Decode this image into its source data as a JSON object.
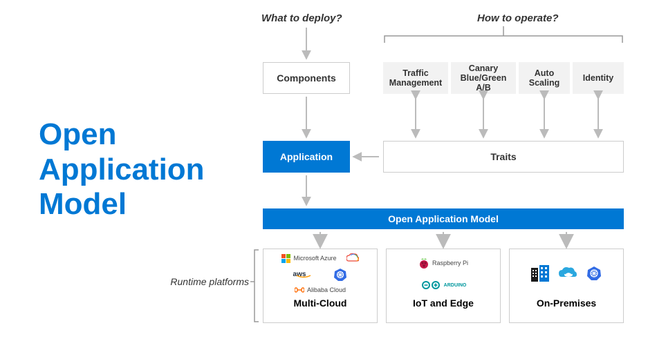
{
  "title": "Open Application Model",
  "questions": {
    "deploy": "What to deploy?",
    "operate": "How to operate?"
  },
  "components_label": "Components",
  "application_label": "Application",
  "traits_label": "Traits",
  "trait_items": {
    "traffic": "Traffic Management",
    "canary": "Canary Blue/Green A/B",
    "auto": "Auto Scaling",
    "identity": "Identity"
  },
  "oam_bar_label": "Open Application Model",
  "runtime_label": "Runtime platforms",
  "platforms": {
    "multicloud": {
      "label": "Multi-Cloud",
      "providers": {
        "azure": "Microsoft Azure",
        "gcp": "",
        "aws": "aws",
        "k8s": "",
        "alibaba": "Alibaba Cloud"
      }
    },
    "iot": {
      "label": "IoT and Edge",
      "providers": {
        "rpi": "Raspberry Pi",
        "arduino": "ARDUINO"
      }
    },
    "onprem": {
      "label": "On-Premises"
    }
  }
}
